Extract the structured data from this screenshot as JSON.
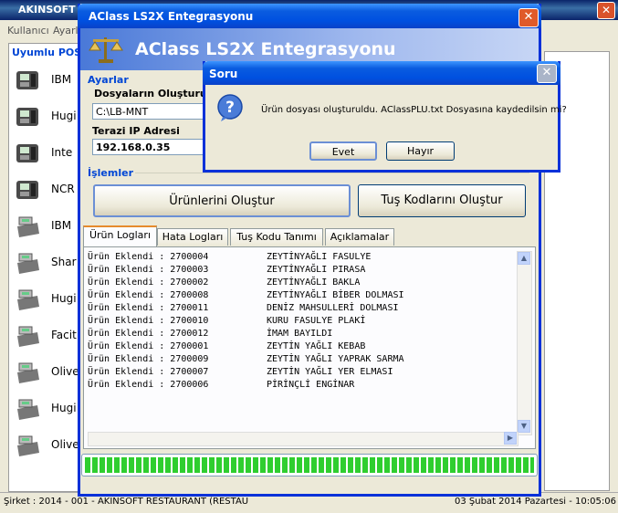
{
  "bg_window": {
    "title": "AKINSOFT",
    "menu": [
      "Kullanıcı",
      "Ayarl"
    ],
    "panel_title": "Uyumlu POS",
    "pos_items": [
      {
        "label": "IBM",
        "icon": "scale-icon"
      },
      {
        "label": "Hugi",
        "icon": "scale-icon"
      },
      {
        "label": "Inte",
        "icon": "scale-icon"
      },
      {
        "label": "NCR",
        "icon": "scale-icon"
      },
      {
        "label": "IBM",
        "icon": "cash-register-icon"
      },
      {
        "label": "Shar",
        "icon": "cash-register-icon"
      },
      {
        "label": "Hugi",
        "icon": "cash-register-icon"
      },
      {
        "label": "Facit",
        "icon": "cash-register-icon"
      },
      {
        "label": "Olive",
        "icon": "cash-register-icon"
      },
      {
        "label": "Hugi",
        "icon": "cash-register-icon"
      },
      {
        "label": "Olive",
        "icon": "cash-register-icon"
      }
    ],
    "status_left": "Şirket : 2014 - 001 - AKINSOFT RESTAURANT (RESTAU",
    "status_right": "03 Şubat 2014 Pazartesi - 10:05:06"
  },
  "aclass": {
    "title": "AClass LS2X Entegrasyonu",
    "banner": "AClass LS2X Entegrasyonu",
    "settings_group": "Ayarlar",
    "folder_label": "Dosyaların Oluşturula",
    "folder_value": "C:\\LB-MNT",
    "ip_label": "Terazi IP Adresi",
    "ip_value": "192.168.0.35",
    "actions_group": "İşlemler",
    "btn_create_products": "Ürünlerini Oluştur",
    "btn_create_keys": "Tuş Kodlarını Oluştur",
    "tabs": [
      "Ürün Logları",
      "Hata Logları",
      "Tuş Kodu Tanımı",
      "Açıklamalar"
    ],
    "log": [
      {
        "left": "Ürün Eklendi : 2700004",
        "right": "ZEYTİNYAĞLI FASULYE"
      },
      {
        "left": "Ürün Eklendi : 2700003",
        "right": "ZEYTİNYAĞLI PIRASA"
      },
      {
        "left": "Ürün Eklendi : 2700002",
        "right": "ZEYTİNYAĞLI BAKLA"
      },
      {
        "left": "Ürün Eklendi : 2700008",
        "right": "ZEYTİNYAĞLI BİBER DOLMASI"
      },
      {
        "left": "Ürün Eklendi : 2700011",
        "right": "DENİZ MAHSULLERİ DOLMASI"
      },
      {
        "left": "Ürün Eklendi : 2700010",
        "right": "KURU FASULYE PLAKİ"
      },
      {
        "left": "Ürün Eklendi : 2700012",
        "right": "İMAM BAYILDI"
      },
      {
        "left": "Ürün Eklendi : 2700001",
        "right": "ZEYTİN YAĞLI KEBAB"
      },
      {
        "left": "Ürün Eklendi : 2700009",
        "right": "ZEYTİN YAĞLI YAPRAK SARMA"
      },
      {
        "left": "Ürün Eklendi : 2700007",
        "right": "ZEYTİN YAĞLI YER ELMASI"
      },
      {
        "left": "Ürün Eklendi : 2700006",
        "right": "PİRİNÇLİ ENGİNAR"
      }
    ],
    "progress_fraction": 1.0
  },
  "dialog": {
    "title": "Soru",
    "message": "Ürün dosyası oluşturuldu. AClassPLU.txt Dosyasına kaydedilsin mi?",
    "yes": "Evet",
    "no": "Hayır"
  },
  "colors": {
    "xp_blue": "#0831d9",
    "group_blue": "#0046d5",
    "progress_green": "#2fce2f"
  }
}
